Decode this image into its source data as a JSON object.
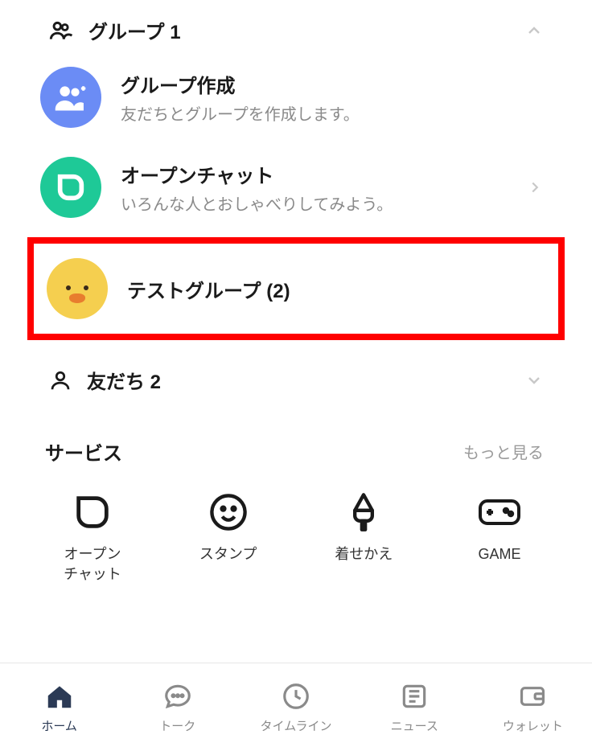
{
  "groups": {
    "header_label": "グループ 1",
    "items": [
      {
        "title": "グループ作成",
        "sub": "友だちとグループを作成します。"
      },
      {
        "title": "オープンチャット",
        "sub": "いろんな人とおしゃべりしてみよう。"
      },
      {
        "title": "テストグループ  (2)"
      }
    ]
  },
  "friends": {
    "header_label": "友だち 2"
  },
  "services": {
    "title": "サービス",
    "more_label": "もっと見る",
    "items": [
      {
        "label": "オープン\nチャット"
      },
      {
        "label": "スタンプ"
      },
      {
        "label": "着せかえ"
      },
      {
        "label": "GAME"
      }
    ]
  },
  "tabs": [
    {
      "label": "ホーム"
    },
    {
      "label": "トーク"
    },
    {
      "label": "タイムライン"
    },
    {
      "label": "ニュース"
    },
    {
      "label": "ウォレット"
    }
  ]
}
